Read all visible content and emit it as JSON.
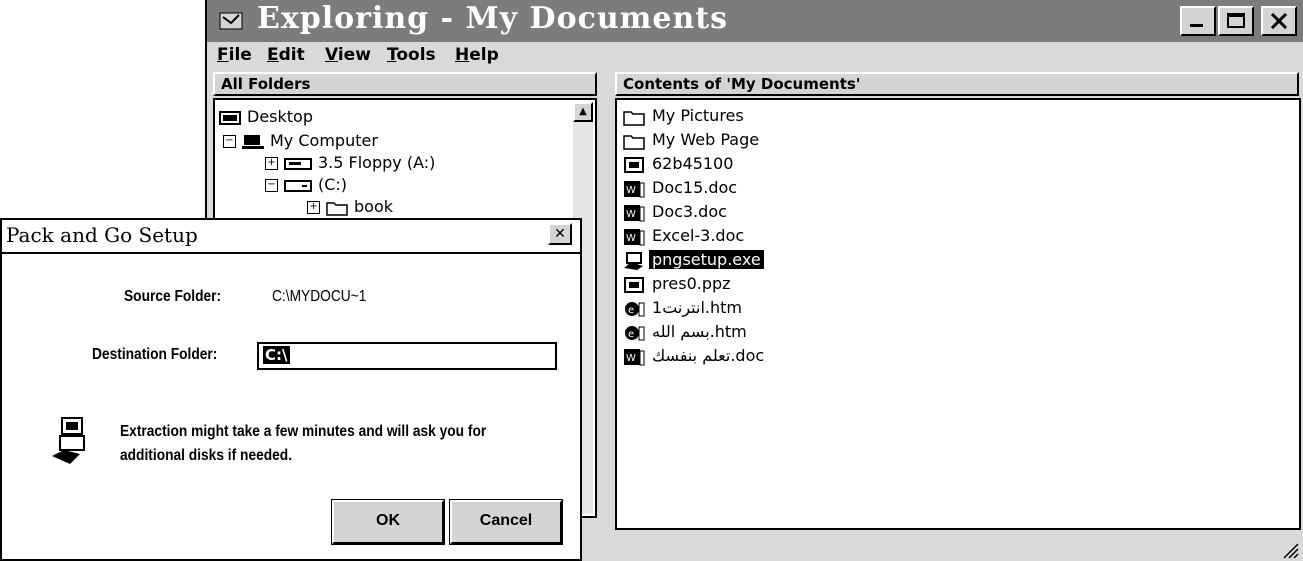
{
  "explorer": {
    "title": "Exploring - My Documents",
    "menu": [
      "File",
      "Edit",
      "View",
      "Tools",
      "Help"
    ],
    "folders_header": "All Folders",
    "contents_header": "Contents of 'My Documents'",
    "tree": [
      {
        "label": "Desktop",
        "icon": "desktop-icon"
      },
      {
        "label": "My Computer",
        "icon": "computer-icon",
        "expander": "−"
      },
      {
        "label": "3.5 Floppy (A:)",
        "icon": "floppy-icon",
        "expander": "+"
      },
      {
        "label": "(C:)",
        "icon": "drive-icon",
        "expander": "−"
      },
      {
        "label": "book",
        "icon": "folder-icon",
        "expander": "+"
      }
    ],
    "files": [
      {
        "name": "My Pictures",
        "icon": "folder-icon",
        "selected": false
      },
      {
        "name": "My Web Page",
        "icon": "folder-icon",
        "selected": false
      },
      {
        "name": "62b45100",
        "icon": "file-icon",
        "selected": false
      },
      {
        "name": "Doc15.doc",
        "icon": "word-doc-icon",
        "selected": false
      },
      {
        "name": "Doc3.doc",
        "icon": "word-doc-icon",
        "selected": false
      },
      {
        "name": "Excel-3.doc",
        "icon": "word-doc-icon",
        "selected": false
      },
      {
        "name": "pngsetup.exe",
        "icon": "setup-exe-icon",
        "selected": true
      },
      {
        "name": "pres0.ppz",
        "icon": "file-icon",
        "selected": false
      },
      {
        "name": "1انترنت.htm",
        "icon": "web-page-icon",
        "selected": false
      },
      {
        "name": "بسم الله.htm",
        "icon": "web-page-icon",
        "selected": false
      },
      {
        "name": "تعلم بنفسك.doc",
        "icon": "word-doc-icon",
        "selected": false
      }
    ]
  },
  "dialog": {
    "title": "Pack and Go Setup",
    "source_label": "Source Folder:",
    "source_value": "C:\\MYDOCU~1",
    "dest_label": "Destination Folder:",
    "dest_value": "C:\\",
    "message_line1": "Extraction might take a few minutes and will ask you for",
    "message_line2": "additional disks if needed.",
    "ok_label": "OK",
    "cancel_label": "Cancel"
  }
}
